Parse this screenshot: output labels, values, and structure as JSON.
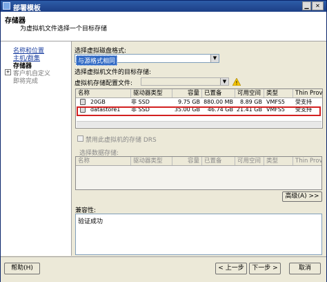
{
  "window": {
    "title": "部署模板"
  },
  "header": {
    "title": "存储器",
    "subtitle": "为虚拟机文件选择一个目标存储"
  },
  "nav": {
    "items": [
      {
        "label": "名称和位置",
        "style": "link"
      },
      {
        "label": "主机/群集",
        "style": "link"
      },
      {
        "label": "存储器",
        "style": "bold"
      },
      {
        "label": "客户机自定义",
        "style": "gray"
      },
      {
        "label": "即将完成",
        "style": "gray"
      }
    ]
  },
  "disk_format": {
    "label": "选择虚拟磁盘格式:",
    "value": "与源格式相同"
  },
  "target_storage": {
    "label": "选择虚拟机文件的目标存储:"
  },
  "profile": {
    "label": "虚拟机存储配置文件:",
    "value": ""
  },
  "datastores": {
    "columns": [
      "名称",
      "驱动器类型",
      "容量",
      "已置备",
      "可用空间",
      "类型",
      "Thin Provisio"
    ],
    "rows": [
      {
        "name": "20GB",
        "drive": "非 SSD",
        "capacity": "9.75 GB",
        "provisioned": "880.00 MB",
        "free": "8.89 GB",
        "type": "VMFS5",
        "thin": "受支持"
      },
      {
        "name": "datastore1",
        "drive": "非 SSD",
        "capacity": "35.00 GB",
        "provisioned": "46.74 GB",
        "free": "21.41 GB",
        "type": "VMFS5",
        "thin": "受支持"
      }
    ]
  },
  "drs": {
    "label": "禁用此虚拟机的存储 DRS"
  },
  "select_datastore": {
    "label": "选择数据存储:",
    "columns": [
      "名称",
      "驱动器类型",
      "容量",
      "已置备",
      "可用空间",
      "类型",
      "Thin Provisio"
    ]
  },
  "advanced_button": "高级(A) >>",
  "compatibility": {
    "label": "兼容性:",
    "value": "验证成功"
  },
  "footer": {
    "help": "帮助(H)",
    "back": "< 上一步",
    "next": "下一步 >",
    "cancel": "取消"
  },
  "colors": {
    "highlight": "#d21f1f",
    "title": "#1c3f86",
    "selection": "#316ac5"
  }
}
